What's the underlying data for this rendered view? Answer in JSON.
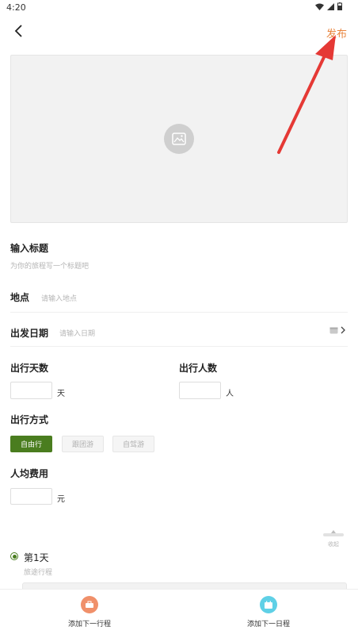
{
  "status": {
    "time": "4:20"
  },
  "header": {
    "publish_label": "发布"
  },
  "form": {
    "title_label": "输入标题",
    "title_placeholder": "为你的旅程写一个标题吧",
    "location_label": "地点",
    "location_placeholder": "请输入地点",
    "date_label": "出发日期",
    "date_placeholder": "请输入日期",
    "days_label": "出行天数",
    "days_unit": "天",
    "people_label": "出行人数",
    "people_unit": "人",
    "mode_label": "出行方式",
    "modes": [
      {
        "label": "自由行",
        "selected": true
      },
      {
        "label": "跟团游",
        "selected": false
      },
      {
        "label": "自驾游",
        "selected": false
      }
    ],
    "cost_label": "人均费用",
    "cost_unit": "元"
  },
  "collapse": {
    "label": "收起"
  },
  "day": {
    "title": "第1天",
    "subtitle": "旅途行程"
  },
  "bottom": {
    "add_itinerary_label": "添加下一行程",
    "add_day_label": "添加下一日程"
  },
  "colors": {
    "accent": "#e8843d",
    "selected_chip": "#4a7d1f",
    "annotation_arrow": "#e53935",
    "itinerary_icon": "#f0906a",
    "day_icon": "#5fd0e6"
  }
}
